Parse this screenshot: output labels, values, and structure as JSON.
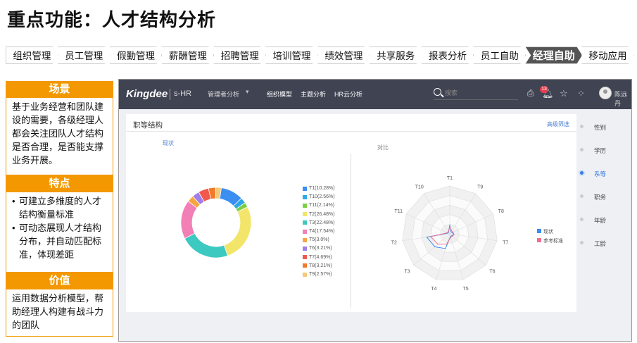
{
  "page_title": "重点功能：人才结构分析",
  "nav": {
    "items": [
      "组织管理",
      "员工管理",
      "假勤管理",
      "薪酬管理",
      "招聘管理",
      "培训管理",
      "绩效管理",
      "共享服务",
      "报表分析",
      "员工自助",
      "经理自助",
      "移动应用"
    ],
    "active_index": 10
  },
  "sections": {
    "scene": {
      "title": "场景",
      "text": "基于业务经营和团队建设的需要，各级经理人都会关注团队人才结构是否合理，是否能支撑业务开展。"
    },
    "features": {
      "title": "特点",
      "items": [
        "可建立多维度的人才结构衡量标准",
        "可动态展现人才结构分布，并自动匹配标准，体现差距"
      ]
    },
    "value": {
      "title": "价值",
      "text": "运用数据分析模型，帮助经理人构建有战斗力的团队"
    }
  },
  "app": {
    "logo": "Kingdee",
    "product": "s-HR",
    "menu": "管理者分析",
    "tabs": [
      "组织模型",
      "主题分析",
      "HR云分析"
    ],
    "search_placeholder": "搜索",
    "notification_count": "13",
    "user_name": "陈远丹",
    "card_title": "职等结构",
    "card_link": "高级筛选",
    "left_subtitle": "现状",
    "right_subtitle": "对比",
    "right_nav": {
      "items": [
        "性别",
        "学历",
        "系等",
        "职务",
        "年龄",
        "工龄"
      ],
      "active_index": 2
    }
  },
  "chart_data": [
    {
      "type": "pie",
      "subtitle": "现状",
      "donut": true,
      "categories": [
        "T1",
        "T10",
        "T11",
        "T2",
        "T3",
        "T4",
        "T5",
        "T6",
        "T7",
        "T8",
        "T9"
      ],
      "legend_labels": [
        "T1(10.28%)",
        "T10(2.56%)",
        "T11(2.14%)",
        "T2(26.48%)",
        "T3(22.48%)",
        "T4(17.54%)",
        "T5(3.0%)",
        "T6(3.21%)",
        "T7(4.69%)",
        "T8(3.21%)",
        "T9(2.57%)"
      ],
      "values": [
        10.28,
        2.56,
        2.14,
        26.48,
        22.48,
        17.54,
        3.0,
        3.21,
        4.69,
        3.21,
        2.57
      ],
      "colors": [
        "#3b8ff0",
        "#2fa7e6",
        "#7bcf46",
        "#f3e56a",
        "#3cc9c0",
        "#f27fb6",
        "#f7a541",
        "#a07ee8",
        "#f0594c",
        "#f27a2a",
        "#f5c87a"
      ],
      "legend_position": "right"
    },
    {
      "type": "radar",
      "subtitle": "对比",
      "axes": [
        "T1",
        "T9",
        "T8",
        "T7",
        "T6",
        "T5",
        "T4",
        "T3",
        "T2",
        "T11",
        "T10"
      ],
      "series": [
        {
          "name": "现状",
          "color": "#3b8ff0",
          "values": [
            10.28,
            2.57,
            3.21,
            4.69,
            3.21,
            3.0,
            17.54,
            22.48,
            26.48,
            2.14,
            2.56
          ]
        },
        {
          "name": "参考标准",
          "color": "#ef6d8f",
          "values": [
            8,
            4,
            4,
            5,
            4,
            4,
            12,
            18,
            22,
            3,
            3
          ]
        }
      ],
      "legend_position": "right"
    }
  ]
}
